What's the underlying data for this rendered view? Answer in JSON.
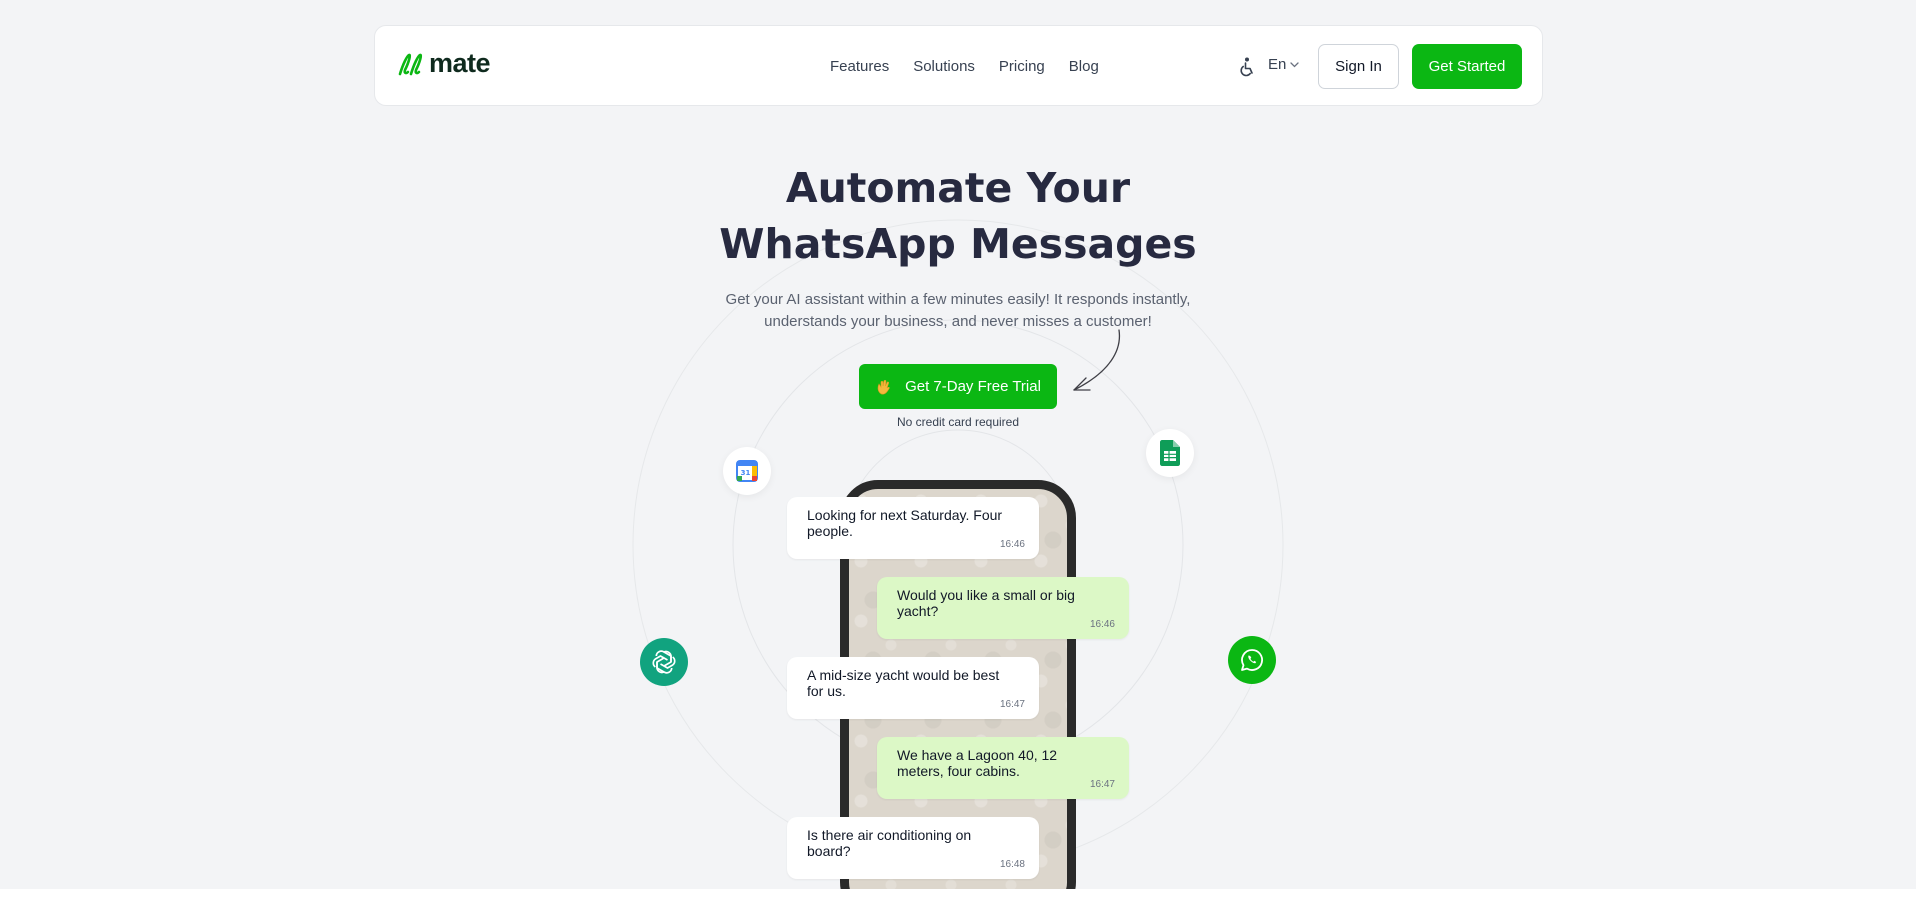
{
  "header": {
    "logo_text": "mate",
    "nav": [
      "Features",
      "Solutions",
      "Pricing",
      "Blog"
    ],
    "language": "En",
    "signin_label": "Sign In",
    "get_started_label": "Get Started"
  },
  "hero": {
    "title_line1": "Automate Your",
    "title_line2": "WhatsApp Messages",
    "subtitle_line1": "Get your AI assistant within a few minutes easily! It responds instantly,",
    "subtitle_line2": "understands your business, and never misses a customer!",
    "cta_label": "Get 7-Day Free Trial",
    "cta_note": "No credit card required"
  },
  "chat": {
    "messages": [
      {
        "text": "Looking for next Saturday. Four people.",
        "time": "16:46",
        "direction": "in"
      },
      {
        "text": "Would you like a small or big yacht?",
        "time": "16:46",
        "direction": "out"
      },
      {
        "text": "A mid-size yacht would be best for us.",
        "time": "16:47",
        "direction": "in"
      },
      {
        "text": "We have a Lagoon 40, 12 meters, four cabins.",
        "time": "16:47",
        "direction": "out"
      },
      {
        "text": "Is there air conditioning on board?",
        "time": "16:48",
        "direction": "in"
      }
    ]
  },
  "integrations": [
    "google-calendar-icon",
    "google-sheets-icon",
    "chatgpt-icon",
    "whatsapp-icon"
  ],
  "colors": {
    "brand_green": "#0bb713",
    "title_color": "#272a40",
    "outgoing_bubble": "#dcf8c6",
    "gpt_teal": "#11a37f"
  }
}
